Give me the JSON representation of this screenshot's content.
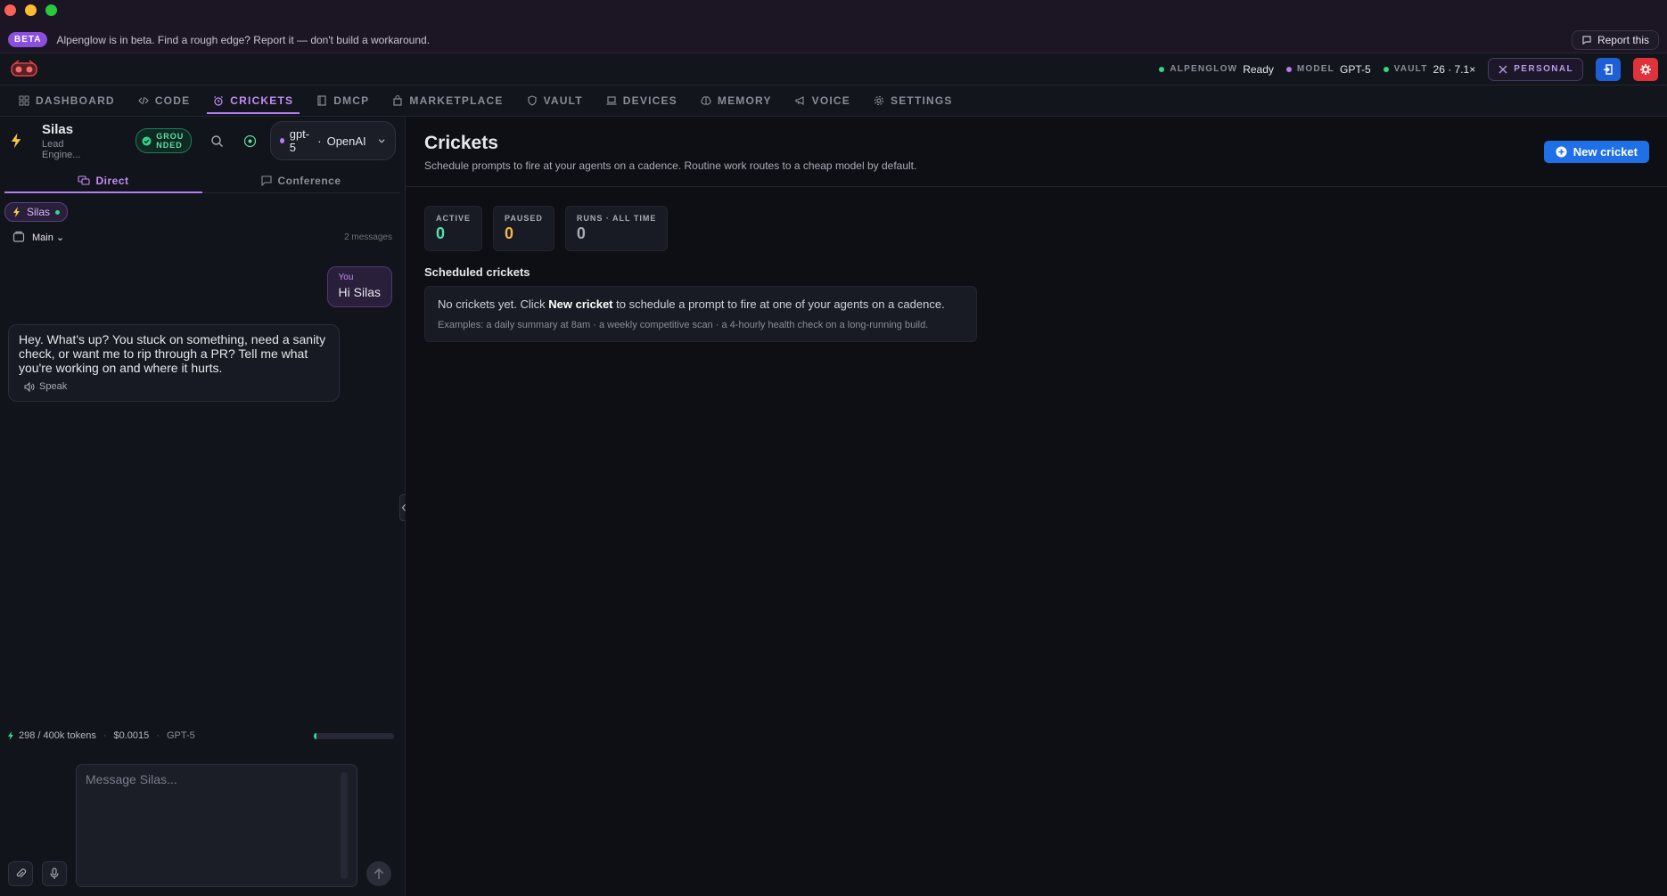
{
  "beta": {
    "badge": "BETA",
    "text": "Alpenglow is in beta. Find a rough edge? Report it — don't build a workaround.",
    "report_label": "Report this"
  },
  "status": {
    "alpenglow_key": "ALPENGLOW",
    "alpenglow_val": "Ready",
    "model_key": "MODEL",
    "model_val": "GPT-5",
    "vault_key": "VAULT",
    "vault_val": "26 · 7.1×",
    "personal_label": "PERSONAL"
  },
  "colors": {
    "accent": "#b47cf0",
    "ok": "#36d38a",
    "blue": "#1f6fe6",
    "red": "#e0323a"
  },
  "nav": {
    "tabs": [
      {
        "label": "DASHBOARD",
        "icon": "grid-icon"
      },
      {
        "label": "CODE",
        "icon": "code-icon"
      },
      {
        "label": "CRICKETS",
        "icon": "alarm-icon"
      },
      {
        "label": "DMCP",
        "icon": "book-icon"
      },
      {
        "label": "MARKETPLACE",
        "icon": "bag-icon"
      },
      {
        "label": "VAULT",
        "icon": "shield-icon"
      },
      {
        "label": "DEVICES",
        "icon": "laptop-icon"
      },
      {
        "label": "MEMORY",
        "icon": "brain-icon"
      },
      {
        "label": "VOICE",
        "icon": "megaphone-icon"
      },
      {
        "label": "SETTINGS",
        "icon": "gear-icon"
      }
    ]
  },
  "agent": {
    "name": "Silas",
    "role": "Lead Engine...",
    "grounded_line1": "GROU",
    "grounded_line2": "NDED",
    "model": "gpt-5",
    "sep": "·",
    "provider": "OpenAI"
  },
  "chat": {
    "tab_direct": "Direct",
    "tab_conference": "Conference",
    "chip": "Silas",
    "thread": "Main",
    "count": "2 messages",
    "you_label": "You",
    "you_msg": "Hi Silas",
    "ai_msg": "Hey. What's up? You stuck on something, need a sanity check, or want me to rip through a PR? Tell me what you're working on and where it hurts.",
    "speak": "Speak",
    "tokens": "298 / 400k tokens",
    "cost": "$0.0015",
    "model": "GPT-5",
    "token_fraction": 0.03,
    "placeholder": "Message Silas..."
  },
  "page": {
    "title": "Crickets",
    "subtitle": "Schedule prompts to fire at your agents on a cadence. Routine work routes to a cheap model by default.",
    "new_label": "New cricket",
    "stats": [
      {
        "label": "ACTIVE",
        "value": "0",
        "color": "#4fe3b0"
      },
      {
        "label": "PAUSED",
        "value": "0",
        "color": "#f2b845"
      },
      {
        "label": "RUNS · ALL TIME",
        "value": "0",
        "color": "#a8abb6"
      }
    ],
    "section": "Scheduled crickets",
    "empty_pre": "No crickets yet. Click ",
    "empty_bold": "New cricket",
    "empty_post": " to schedule a prompt to fire at one of your agents on a cadence.",
    "examples": "Examples: a daily summary at 8am · a weekly competitive scan · a 4-hourly health check on a long-running build."
  }
}
